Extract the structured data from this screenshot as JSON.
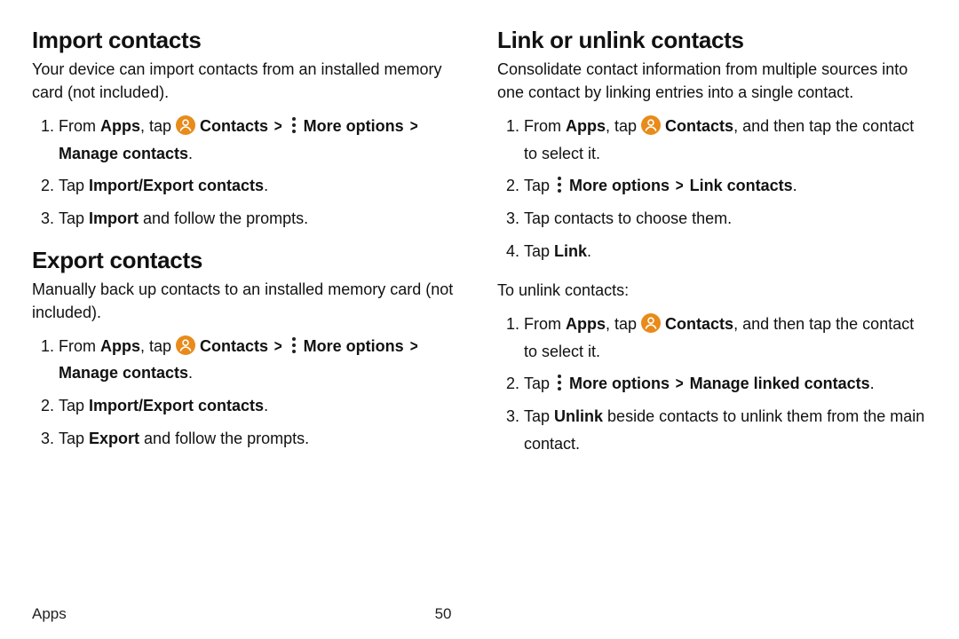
{
  "footer": {
    "section": "Apps",
    "page": "50"
  },
  "left": {
    "s1": {
      "title": "Import contacts",
      "intro": "Your device can import contacts from an installed memory card (not included).",
      "steps": [
        {
          "segs": [
            {
              "t": "From "
            },
            {
              "t": "Apps",
              "b": true
            },
            {
              "t": ", tap "
            },
            {
              "icon": "contacts"
            },
            {
              "t": " "
            },
            {
              "t": "Contacts",
              "b": true
            },
            {
              "t": " "
            },
            {
              "chev": true
            },
            {
              "t": " "
            },
            {
              "icon": "more"
            },
            {
              "t": " "
            },
            {
              "t": "More options",
              "b": true
            },
            {
              "t": " "
            },
            {
              "chev": true
            },
            {
              "t": " "
            },
            {
              "t": "Manage contacts",
              "b": true
            },
            {
              "t": "."
            }
          ]
        },
        {
          "segs": [
            {
              "t": "Tap "
            },
            {
              "t": "Import/Export contacts",
              "b": true
            },
            {
              "t": "."
            }
          ]
        },
        {
          "segs": [
            {
              "t": "Tap "
            },
            {
              "t": "Import",
              "b": true
            },
            {
              "t": " and follow the prompts."
            }
          ]
        }
      ]
    },
    "s2": {
      "title": "Export contacts",
      "intro": "Manually back up contacts to an installed memory card (not included).",
      "steps": [
        {
          "segs": [
            {
              "t": "From "
            },
            {
              "t": "Apps",
              "b": true
            },
            {
              "t": ", tap "
            },
            {
              "icon": "contacts"
            },
            {
              "t": " "
            },
            {
              "t": "Contacts",
              "b": true
            },
            {
              "t": " "
            },
            {
              "chev": true
            },
            {
              "t": " "
            },
            {
              "icon": "more"
            },
            {
              "t": " "
            },
            {
              "t": "More options",
              "b": true
            },
            {
              "t": " "
            },
            {
              "chev": true
            },
            {
              "t": " "
            },
            {
              "t": "Manage contacts",
              "b": true
            },
            {
              "t": "."
            }
          ]
        },
        {
          "segs": [
            {
              "t": "Tap "
            },
            {
              "t": "Import/Export contacts",
              "b": true
            },
            {
              "t": "."
            }
          ]
        },
        {
          "segs": [
            {
              "t": "Tap "
            },
            {
              "t": "Export",
              "b": true
            },
            {
              "t": " and follow the prompts."
            }
          ]
        }
      ]
    }
  },
  "right": {
    "s1": {
      "title": "Link or unlink contacts",
      "intro": "Consolidate contact information from multiple sources into one contact by linking entries into a single contact.",
      "steps": [
        {
          "segs": [
            {
              "t": "From "
            },
            {
              "t": "Apps",
              "b": true
            },
            {
              "t": ", tap "
            },
            {
              "icon": "contacts"
            },
            {
              "t": " "
            },
            {
              "t": "Contacts",
              "b": true
            },
            {
              "t": ", and then tap the contact to select it."
            }
          ]
        },
        {
          "segs": [
            {
              "t": "Tap "
            },
            {
              "icon": "more"
            },
            {
              "t": " "
            },
            {
              "t": "More options",
              "b": true
            },
            {
              "t": " "
            },
            {
              "chev": true
            },
            {
              "t": " "
            },
            {
              "t": "Link contacts",
              "b": true
            },
            {
              "t": "."
            }
          ]
        },
        {
          "segs": [
            {
              "t": "Tap contacts to choose them."
            }
          ]
        },
        {
          "segs": [
            {
              "t": "Tap "
            },
            {
              "t": "Link",
              "b": true
            },
            {
              "t": "."
            }
          ]
        }
      ],
      "sub": "To unlink contacts:",
      "steps2": [
        {
          "segs": [
            {
              "t": "From "
            },
            {
              "t": "Apps",
              "b": true
            },
            {
              "t": ", tap "
            },
            {
              "icon": "contacts"
            },
            {
              "t": " "
            },
            {
              "t": "Contacts",
              "b": true
            },
            {
              "t": ", and then tap the contact to select it."
            }
          ]
        },
        {
          "segs": [
            {
              "t": "Tap "
            },
            {
              "icon": "more"
            },
            {
              "t": " "
            },
            {
              "t": "More options",
              "b": true
            },
            {
              "t": " "
            },
            {
              "chev": true
            },
            {
              "t": " "
            },
            {
              "t": "Manage linked contacts",
              "b": true
            },
            {
              "t": "."
            }
          ]
        },
        {
          "segs": [
            {
              "t": "Tap "
            },
            {
              "t": "Unlink",
              "b": true
            },
            {
              "t": " beside contacts to unlink them from the main contact."
            }
          ]
        }
      ]
    }
  }
}
